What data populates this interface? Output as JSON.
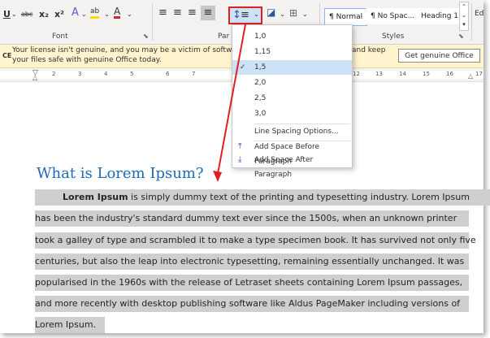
{
  "ribbon": {
    "font_group_label": "Font",
    "paragraph_group_label": "Par",
    "styles_group_label": "Styles",
    "edit_label": "Ed",
    "font_tools": [
      "U",
      "abc",
      "x₂",
      "x²",
      "A",
      "ab",
      "A"
    ],
    "styles": [
      "¶ Normal",
      "¶ No Spac...",
      "Heading 1"
    ]
  },
  "license": {
    "tag": "CE",
    "line1": "Your license isn't genuine, and you may be a victim of softwa",
    "line2": "your files safe with genuine Office today.",
    "line3": "and keep",
    "button": "Get genuine Office"
  },
  "ruler": {
    "left_ticks": [
      "2",
      "3",
      "4",
      "5",
      "6",
      "7"
    ],
    "right_ticks": [
      "12",
      "13",
      "14",
      "15",
      "16",
      "17"
    ]
  },
  "line_spacing_menu": {
    "options": [
      "1,0",
      "1,15",
      "1,5",
      "2,0",
      "2,5",
      "3,0"
    ],
    "selected": "1,5",
    "more": "Line Spacing Options...",
    "add_before": "Add Space Before Paragraph",
    "add_after": "Add Space After Paragraph"
  },
  "document": {
    "heading": "What is Lorem Ipsum?",
    "lead_bold": "Lorem Ipsum",
    "lines": [
      " is simply dummy text of the printing and typesetting industry. Lorem Ipsum",
      "has been the industry's standard dummy text ever since the 1500s, when an unknown printer",
      "took a galley of type and scrambled it to make a type specimen book. It has survived not only five",
      "centuries, but also the leap into electronic typesetting, remaining essentially unchanged. It was",
      "popularised in the 1960s with the release of Letraset sheets containing Lorem Ipsum passages,",
      "and more recently with desktop publishing software like Aldus PageMaker including versions of",
      "Lorem Ipsum."
    ]
  },
  "colors": {
    "accent": "#1f6ab4",
    "highlight": "#cfcfcf",
    "annotation": "#e02020"
  }
}
